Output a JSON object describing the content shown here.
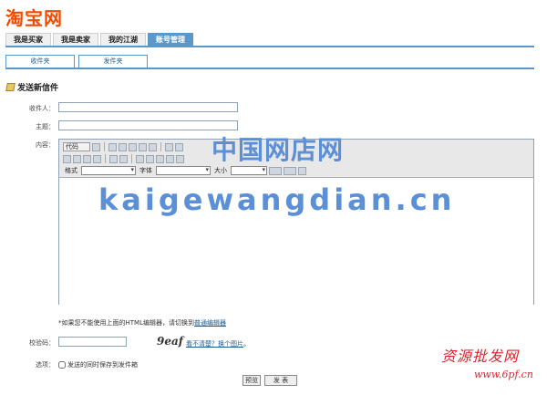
{
  "logo": "淘宝网",
  "main_tabs": [
    "我是买家",
    "我是卖家",
    "我的江湖",
    "账号管理"
  ],
  "sub_tabs": [
    "收件夹",
    "发件夹"
  ],
  "section_title": "发送新信件",
  "form": {
    "recipient_label": "收件人：",
    "subject_label": "主题：",
    "content_label": "内容：",
    "code_label": "校验码：",
    "options_label": "选项："
  },
  "editor": {
    "code_btn": "代码",
    "format_label": "格式",
    "font_label": "字体",
    "size_label": "大小"
  },
  "note": {
    "text": "*如果您不能使用上面的HTML编辑器，请切换到",
    "link": "普通编辑器"
  },
  "captcha": {
    "image_text": "9eaf",
    "link": "看不清楚？换个图片",
    "suffix": "。"
  },
  "save_checkbox": "发送的同时保存到发件箱",
  "buttons": {
    "preview": "预览",
    "send": "发 表"
  },
  "watermarks": {
    "cn": "中国网店网",
    "en": "kaigewangdian.cn",
    "tr": "资源批发网",
    "url": "www.6pf.cn"
  }
}
